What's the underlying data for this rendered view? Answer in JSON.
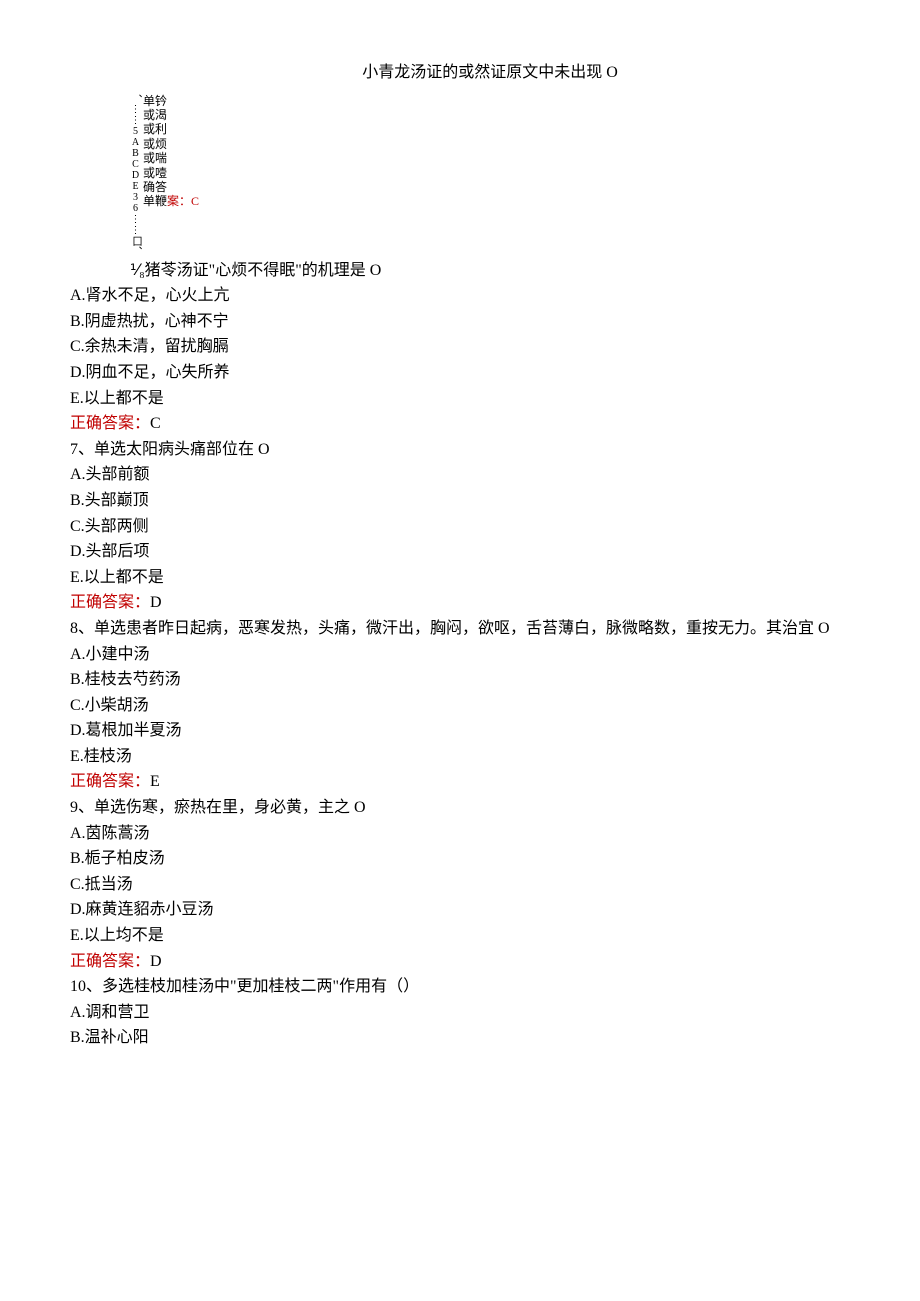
{
  "title": "小青龙汤证的或然证原文中未出现 O",
  "vblock": {
    "col": "、⋮⋮5ABCDE36⋮⋮囗、",
    "opts": [
      "单钤",
      "或渴",
      "或利",
      "或烦",
      "或喘",
      "或噎",
      "确答",
      "单鞭"
    ]
  },
  "line_ans5": "案：C",
  "line_q6": "⅟₈猪苓汤证\"心烦不得眠\"的机理是 O",
  "q6": {
    "a": "A.肾水不足，心火上亢",
    "b": "B.阴虚热扰，心神不宁",
    "c": "C.余热未清，留扰胸膈",
    "d": "D.阴血不足，心失所养",
    "e": "E.以上都不是",
    "ans_label": "正确答案：",
    "ans_val": "C"
  },
  "q7": {
    "stem": "7、单选太阳病头痛部位在 O",
    "a": "A.头部前额",
    "b": "B.头部巅顶",
    "c": "C.头部两侧",
    "d": "D.头部后项",
    "e": "E.以上都不是",
    "ans_label": "正确答案：",
    "ans_val": "D"
  },
  "q8": {
    "stem": "8、单选患者昨日起病，恶寒发热，头痛，微汗出，胸闷，欲呕，舌苔薄白，脉微略数，重按无力。其治宜 O",
    "a": "A.小建中汤",
    "b": "B.桂枝去芍药汤",
    "c": "C.小柴胡汤",
    "d": "D.葛根加半夏汤",
    "e": "E.桂枝汤",
    "ans_label": "正确答案：",
    "ans_val": "E"
  },
  "q9": {
    "stem": "9、单选伤寒，瘀热在里，身必黄，主之 O",
    "a": "A.茵陈蒿汤",
    "b": "B.栀子柏皮汤",
    "c": "C.抵当汤",
    "d": "D.麻黄连貂赤小豆汤",
    "e": "E.以上均不是",
    "ans_label": "正确答案：",
    "ans_val": "D"
  },
  "q10": {
    "stem": "10、多选桂枝加桂汤中\"更加桂枝二两\"作用有（）",
    "a": "A.调和营卫",
    "b": "B.温补心阳"
  }
}
